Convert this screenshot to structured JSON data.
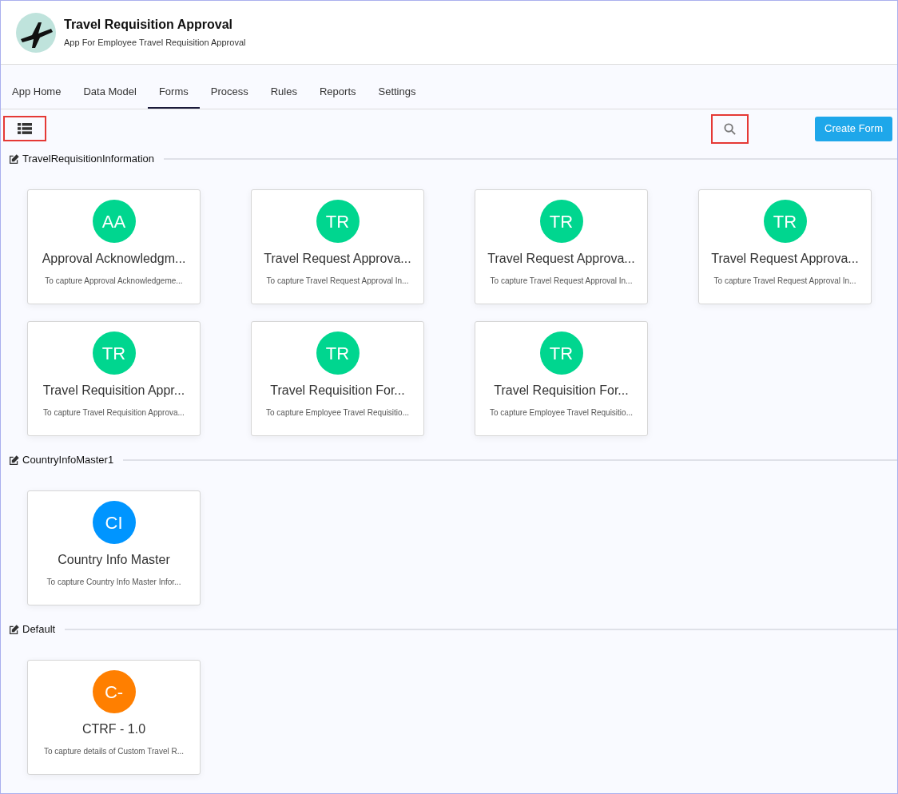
{
  "app": {
    "title": "Travel Requisition Approval",
    "subtitle": "App For Employee Travel Requisition Approval"
  },
  "tabs": [
    {
      "label": "App Home",
      "selected": false
    },
    {
      "label": "Data Model",
      "selected": false
    },
    {
      "label": "Forms",
      "selected": true
    },
    {
      "label": "Process",
      "selected": false
    },
    {
      "label": "Rules",
      "selected": false
    },
    {
      "label": "Reports",
      "selected": false
    },
    {
      "label": "Settings",
      "selected": false
    }
  ],
  "toolbar": {
    "create_button": "Create Form"
  },
  "sections": [
    {
      "name": "TravelRequisitionInformation",
      "forms": [
        {
          "initials": "AA",
          "color": "#00d68f",
          "title": "Approval Acknowledgm...",
          "description": "To capture Approval Acknowledgeme..."
        },
        {
          "initials": "TR",
          "color": "#00d68f",
          "title": "Travel Request Approva...",
          "description": "To capture Travel Request Approval In..."
        },
        {
          "initials": "TR",
          "color": "#00d68f",
          "title": "Travel Request Approva...",
          "description": "To capture Travel Request Approval In..."
        },
        {
          "initials": "TR",
          "color": "#00d68f",
          "title": "Travel Request Approva...",
          "description": "To capture Travel Request Approval In..."
        },
        {
          "initials": "TR",
          "color": "#00d68f",
          "title": "Travel Requisition Appr...",
          "description": "To capture Travel Requisition Approva..."
        },
        {
          "initials": "TR",
          "color": "#00d68f",
          "title": "Travel Requisition For...",
          "description": "To capture Employee Travel Requisitio..."
        },
        {
          "initials": "TR",
          "color": "#00d68f",
          "title": "Travel Requisition For...",
          "description": "To capture Employee Travel Requisitio..."
        }
      ]
    },
    {
      "name": "CountryInfoMaster1",
      "forms": [
        {
          "initials": "CI",
          "color": "#0095ff",
          "title": "Country Info Master",
          "description": "To capture Country Info Master Infor..."
        }
      ]
    },
    {
      "name": "Default",
      "forms": [
        {
          "initials": "C-",
          "color": "#ff7f00",
          "title": "CTRF - 1.0",
          "description": "To capture details of Custom Travel R..."
        }
      ]
    }
  ]
}
